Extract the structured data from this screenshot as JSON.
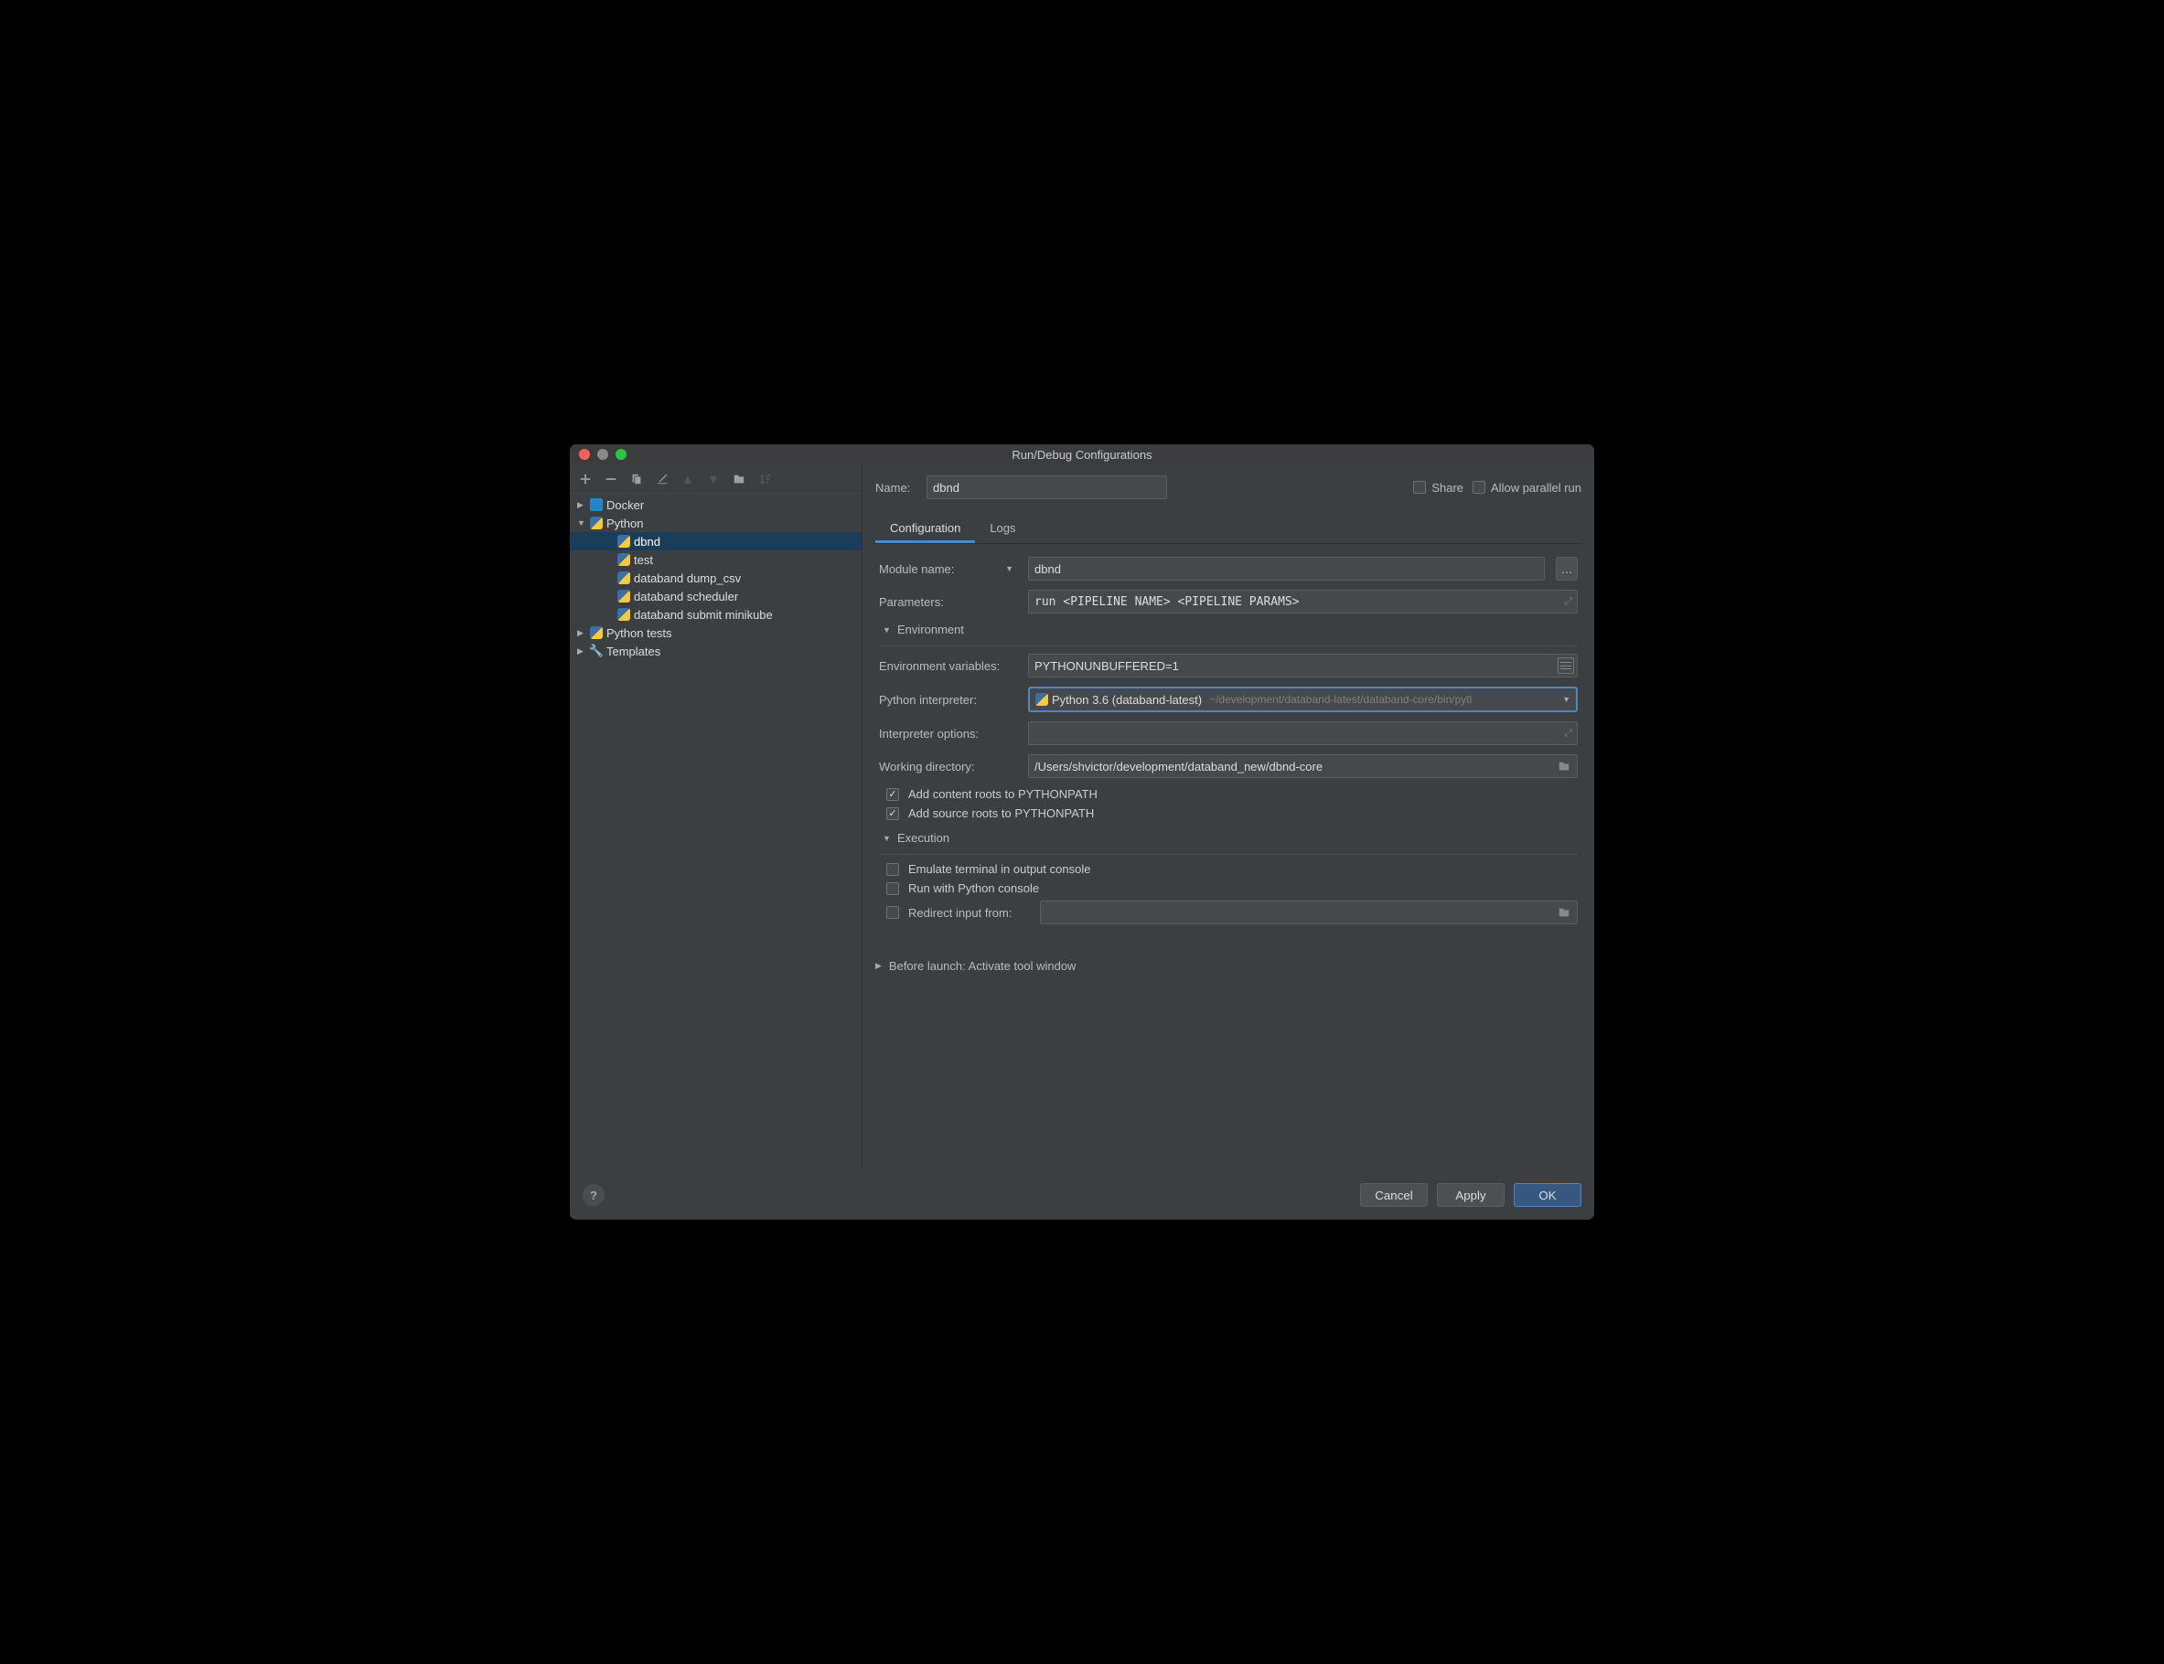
{
  "window": {
    "title": "Run/Debug Configurations"
  },
  "sidebar": {
    "items": [
      {
        "label": "Docker",
        "icon": "docker",
        "depth": 0,
        "expandable": true,
        "expanded": false
      },
      {
        "label": "Python",
        "icon": "python",
        "depth": 0,
        "expandable": true,
        "expanded": true
      },
      {
        "label": "dbnd",
        "icon": "python",
        "depth": 1,
        "selected": true
      },
      {
        "label": "test",
        "icon": "python",
        "depth": 1
      },
      {
        "label": "databand dump_csv",
        "icon": "python",
        "depth": 1
      },
      {
        "label": "databand scheduler",
        "icon": "python",
        "depth": 1
      },
      {
        "label": "databand submit minikube",
        "icon": "python",
        "depth": 1
      },
      {
        "label": "Python tests",
        "icon": "python",
        "depth": 0,
        "expandable": true,
        "expanded": false
      },
      {
        "label": "Templates",
        "icon": "wrench",
        "depth": 0,
        "expandable": true,
        "expanded": false
      }
    ]
  },
  "form": {
    "name_label": "Name:",
    "name_value": "dbnd",
    "share_label": "Share",
    "allow_parallel_label": "Allow parallel run",
    "tabs": {
      "config": "Configuration",
      "logs": "Logs"
    },
    "module_name_label": "Module name:",
    "module_name_value": "dbnd",
    "parameters_label": "Parameters:",
    "parameters_value": "run <PIPELINE NAME> <PIPELINE PARAMS>",
    "env_section": "Environment",
    "env_vars_label": "Environment variables:",
    "env_vars_value": "PYTHONUNBUFFERED=1",
    "interpreter_label": "Python interpreter:",
    "interpreter_name": "Python 3.6 (databand-latest)",
    "interpreter_path": "~/development/databand-latest/databand-core/bin/pytl",
    "interp_options_label": "Interpreter options:",
    "interp_options_value": "",
    "working_dir_label": "Working directory:",
    "working_dir_value": "/Users/shvictor/development/databand_new/dbnd-core",
    "add_content_roots": "Add content roots to PYTHONPATH",
    "add_source_roots": "Add source roots to PYTHONPATH",
    "exec_section": "Execution",
    "emulate_terminal": "Emulate terminal in output console",
    "run_python_console": "Run with Python console",
    "redirect_input": "Redirect input from:",
    "before_launch": "Before launch: Activate tool window"
  },
  "footer": {
    "cancel": "Cancel",
    "apply": "Apply",
    "ok": "OK"
  }
}
